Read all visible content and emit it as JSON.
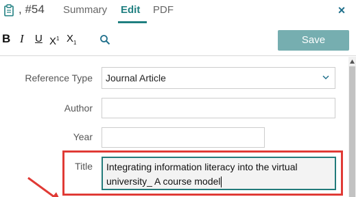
{
  "header": {
    "ref_id": ", #54",
    "tabs": [
      {
        "label": "Summary"
      },
      {
        "label": "Edit"
      },
      {
        "label": "PDF"
      }
    ],
    "close": "×",
    "active_tab": "Edit"
  },
  "toolbar": {
    "bold": "B",
    "italic": "I",
    "underline": "U",
    "superscript": "X",
    "superscript_mark": "1",
    "subscript": "X",
    "subscript_mark": "1",
    "save_label": "Save"
  },
  "form": {
    "reference_type_label": "Reference Type",
    "reference_type_value": "Journal Article",
    "author_label": "Author",
    "author_value": "",
    "year_label": "Year",
    "year_value": "",
    "title_label": "Title",
    "title_value": "Integrating information literacy into the virtual university_ A course model"
  },
  "colors": {
    "accent": "#1f7f80",
    "save_bg": "#76aeb0",
    "highlight": "#e03a35",
    "arrow": "#e03a35"
  }
}
